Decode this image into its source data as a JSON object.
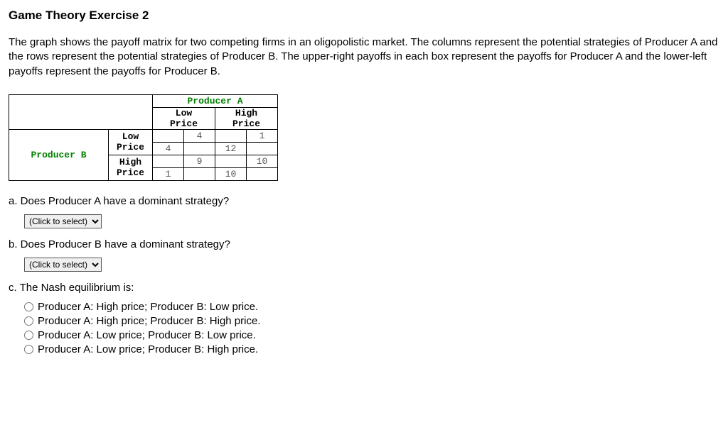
{
  "title": "Game Theory Exercise 2",
  "intro": "The graph shows the payoff matrix for two competing firms in an oligopolistic market. The columns represent the potential strategies of Producer A and the rows represent the potential strategies of Producer B. The upper-right payoffs in each box represent the payoffs for Producer A and the lower-left payoffs represent the payoffs for Producer B.",
  "matrix": {
    "colPlayer": "Producer A",
    "rowPlayer": "Producer B",
    "colStrategies": {
      "s1a": "Low",
      "s1b": "Price",
      "s2a": "High",
      "s2b": "Price"
    },
    "rowStrategies": {
      "s1a": "Low",
      "s1b": "Price",
      "s2a": "High",
      "s2b": "Price"
    },
    "cells": {
      "r1c1": {
        "a": "4",
        "b": "4"
      },
      "r1c2": {
        "a": "1",
        "b": "12"
      },
      "r2c1": {
        "a": "9",
        "b": "1"
      },
      "r2c2": {
        "a": "10",
        "b": "10"
      }
    }
  },
  "questions": {
    "a": {
      "text": "a. Does Producer A have a dominant strategy?",
      "placeholder": "(Click to select)"
    },
    "b": {
      "text": "b. Does Producer B have a dominant strategy?",
      "placeholder": "(Click to select)"
    },
    "c": {
      "text": "c. The Nash equilibrium is:",
      "options": [
        "Producer A: High price; Producer B: Low price.",
        "Producer A: High price; Producer B: High price.",
        "Producer A: Low price; Producer B: Low price.",
        "Producer A: Low price; Producer B: High price."
      ]
    }
  }
}
